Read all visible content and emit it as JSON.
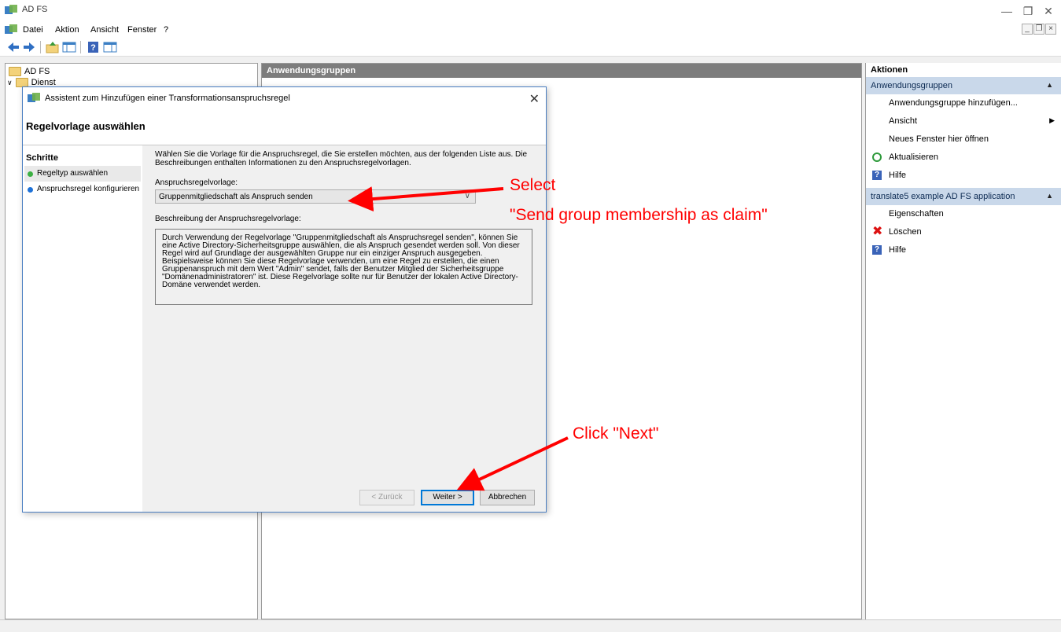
{
  "window": {
    "title": "AD FS"
  },
  "menubar": {
    "items": [
      "Datei",
      "Aktion",
      "Ansicht",
      "Fenster",
      "?"
    ]
  },
  "tree": {
    "root": "AD FS",
    "child": "Dienst"
  },
  "center": {
    "header": "Anwendungsgruppen"
  },
  "actions": {
    "header": "Aktionen",
    "section1": {
      "title": "Anwendungsgruppen",
      "items": [
        {
          "label": "Anwendungsgruppe hinzufügen...",
          "icon": ""
        },
        {
          "label": "Ansicht",
          "icon": "",
          "submenu": true
        },
        {
          "label": "Neues Fenster hier öffnen",
          "icon": ""
        },
        {
          "label": "Aktualisieren",
          "icon": "refresh-icon"
        },
        {
          "label": "Hilfe",
          "icon": "help-icon"
        }
      ]
    },
    "section2": {
      "title": "translate5 example AD FS application",
      "items": [
        {
          "label": "Eigenschaften",
          "icon": ""
        },
        {
          "label": "Löschen",
          "icon": "delete-icon"
        },
        {
          "label": "Hilfe",
          "icon": "help-icon"
        }
      ]
    }
  },
  "dialog": {
    "title": "Assistent zum Hinzufügen einer Transformationsanspruchsregel",
    "page_title": "Regelvorlage auswählen",
    "steps_title": "Schritte",
    "steps": [
      {
        "label": "Regeltyp auswählen",
        "color": "#3cb043"
      },
      {
        "label": "Anspruchsregel konfigurieren",
        "color": "#1e72d8"
      }
    ],
    "intro": "Wählen Sie die Vorlage für die Anspruchsregel, die Sie erstellen möchten, aus der folgenden Liste aus. Die Beschreibungen enthalten Informationen zu den Anspruchsregelvorlagen.",
    "template_label": "Anspruchsregelvorlage:",
    "template_value": "Gruppenmitgliedschaft als Anspruch senden",
    "description_label": "Beschreibung der Anspruchsregelvorlage:",
    "description": "Durch Verwendung der Regelvorlage \"Gruppenmitgliedschaft als Anspruchsregel senden\", können Sie eine Active Directory-Sicherheitsgruppe auswählen, die als Anspruch gesendet werden soll. Von dieser Regel wird auf Grundlage der ausgewählten Gruppe nur ein einziger Anspruch ausgegeben. Beispielsweise können Sie diese Regelvorlage verwenden, um eine Regel zu erstellen, die einen Gruppenanspruch mit dem Wert \"Admin\" sendet, falls der Benutzer Mitglied der Sicherheitsgruppe \"Domänenadministratoren\" ist.  Diese Regelvorlage sollte nur für Benutzer der lokalen Active Directory-Domäne verwendet werden.",
    "buttons": {
      "back": "< Zurück",
      "next": "Weiter >",
      "cancel": "Abbrechen"
    }
  },
  "annotations": {
    "select_line1": "Select",
    "select_line2": "\"Send group membership as claim\"",
    "click_next": "Click \"Next\"",
    "color": "#ff0000"
  }
}
